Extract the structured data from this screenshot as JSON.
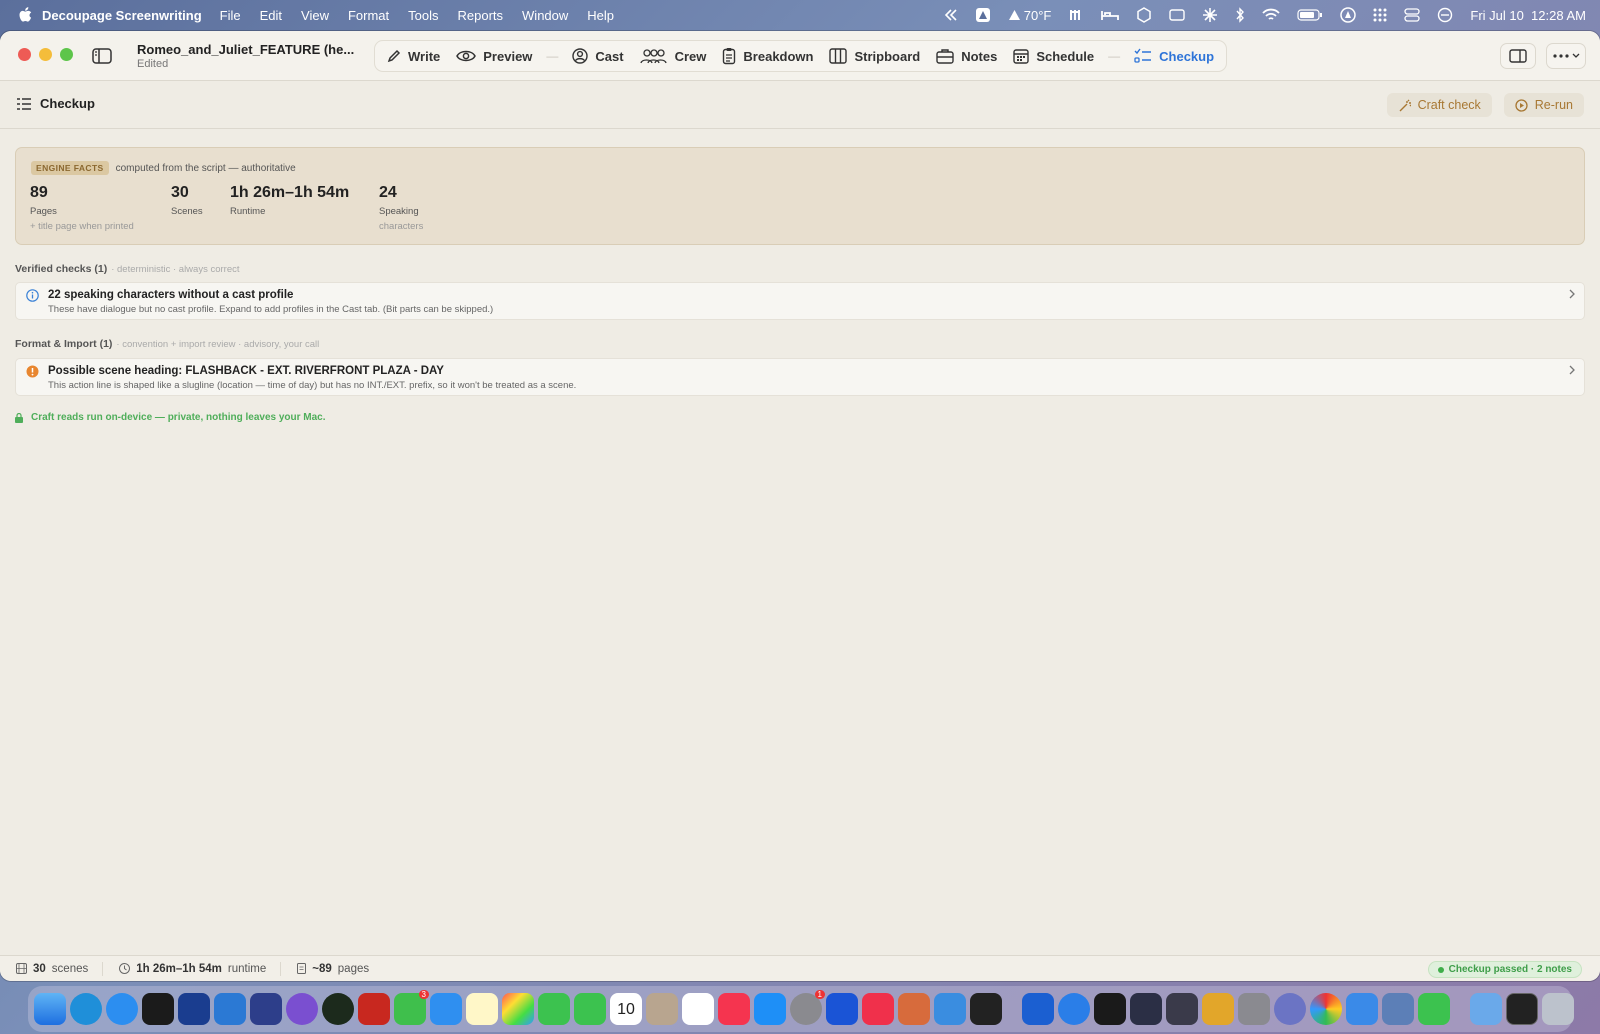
{
  "menubar": {
    "app_name": "Decoupage Screenwriting",
    "menus": [
      "File",
      "Edit",
      "View",
      "Format",
      "Tools",
      "Reports",
      "Window",
      "Help"
    ],
    "weather": "70°F",
    "datetime": "Fri Jul 10  12:28 AM"
  },
  "toolbar": {
    "doc_title": "Romeo_and_Juliet_FEATURE (he...",
    "doc_status": "Edited",
    "modes": [
      {
        "label": "Write",
        "icon": "pencil-icon"
      },
      {
        "label": "Preview",
        "icon": "eye-icon"
      },
      {
        "label": "Cast",
        "icon": "person-circle-icon"
      },
      {
        "label": "Crew",
        "icon": "people-icon"
      },
      {
        "label": "Breakdown",
        "icon": "clipboard-icon"
      },
      {
        "label": "Stripboard",
        "icon": "columns-icon"
      },
      {
        "label": "Notes",
        "icon": "briefcase-icon"
      },
      {
        "label": "Schedule",
        "icon": "calendar-icon"
      },
      {
        "label": "Checkup",
        "icon": "checklist-icon",
        "active": true
      }
    ]
  },
  "section": {
    "title": "Checkup",
    "craft_check": "Craft check",
    "rerun": "Re-run"
  },
  "facts": {
    "badge": "ENGINE FACTS",
    "caption": "computed from the script — authoritative",
    "pages_value": "89",
    "pages_label": "Pages",
    "pages_note": "+ title page when printed",
    "scenes_value": "30",
    "scenes_label": "Scenes",
    "runtime_value": "1h 26m–1h 54m",
    "runtime_label": "Runtime",
    "speaking_value": "24",
    "speaking_label": "Speaking",
    "speaking_label2": "characters"
  },
  "verified": {
    "heading": "Verified checks (1)",
    "sub": "· deterministic · always correct",
    "item_title": "22 speaking characters without a cast profile",
    "item_desc": "These have dialogue but no cast profile. Expand to add profiles in the Cast tab. (Bit parts can be skipped.)"
  },
  "format": {
    "heading": "Format & Import (1)",
    "sub": "· convention + import review · advisory, your call",
    "item_title": "Possible scene heading: FLASHBACK - EXT. RIVERFRONT PLAZA - DAY",
    "item_desc": "This action line is shaped like a slugline (location — time of day) but has no INT./EXT. prefix, so it won't be treated as a scene."
  },
  "privacy": "Craft reads run on-device — private, nothing leaves your Mac.",
  "status": {
    "scenes_value": "30",
    "scenes_label": "scenes",
    "runtime_value": "1h 26m–1h 54m",
    "runtime_label": "runtime",
    "pages_value": "~89",
    "pages_label": "pages",
    "passed": "Checkup passed · 2 notes"
  },
  "dock": {
    "badge_messages": "3",
    "badge_settings": "1",
    "calendar_day": "10"
  },
  "colors": {
    "accent": "#2e74d8",
    "craft": "#a87833",
    "success": "#3fae4a",
    "warning": "#e8862f",
    "info": "#3b82d6"
  }
}
